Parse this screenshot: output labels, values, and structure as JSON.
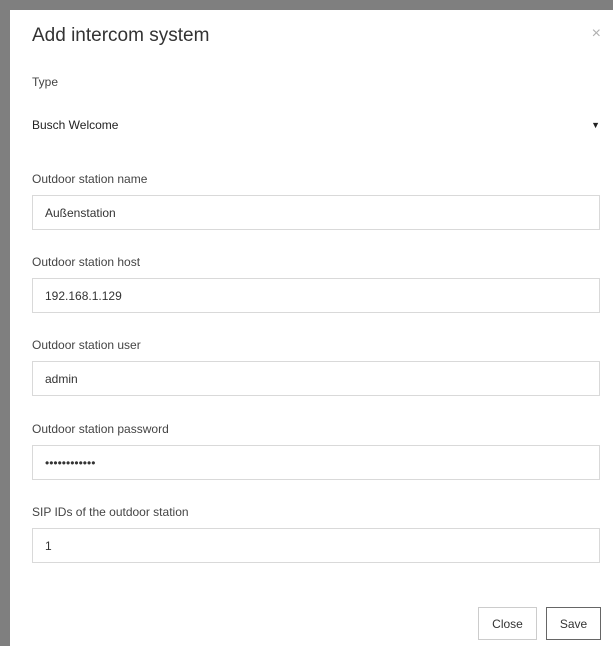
{
  "dialog": {
    "title": "Add intercom system",
    "close_symbol": "×"
  },
  "type_field": {
    "label": "Type",
    "selected": "Busch Welcome",
    "arrow": "▼"
  },
  "fields": {
    "outdoor_station_name": {
      "label": "Outdoor station name",
      "value": "Außenstation"
    },
    "outdoor_station_host": {
      "label": "Outdoor station host",
      "value": "192.168.1.129"
    },
    "outdoor_station_user": {
      "label": "Outdoor station user",
      "value": "admin"
    },
    "outdoor_station_password": {
      "label": "Outdoor station password",
      "value": "••••••••••••"
    },
    "sip_ids": {
      "label": "SIP IDs of the outdoor station",
      "value": "1"
    }
  },
  "footer": {
    "close_label": "Close",
    "save_label": "Save"
  }
}
